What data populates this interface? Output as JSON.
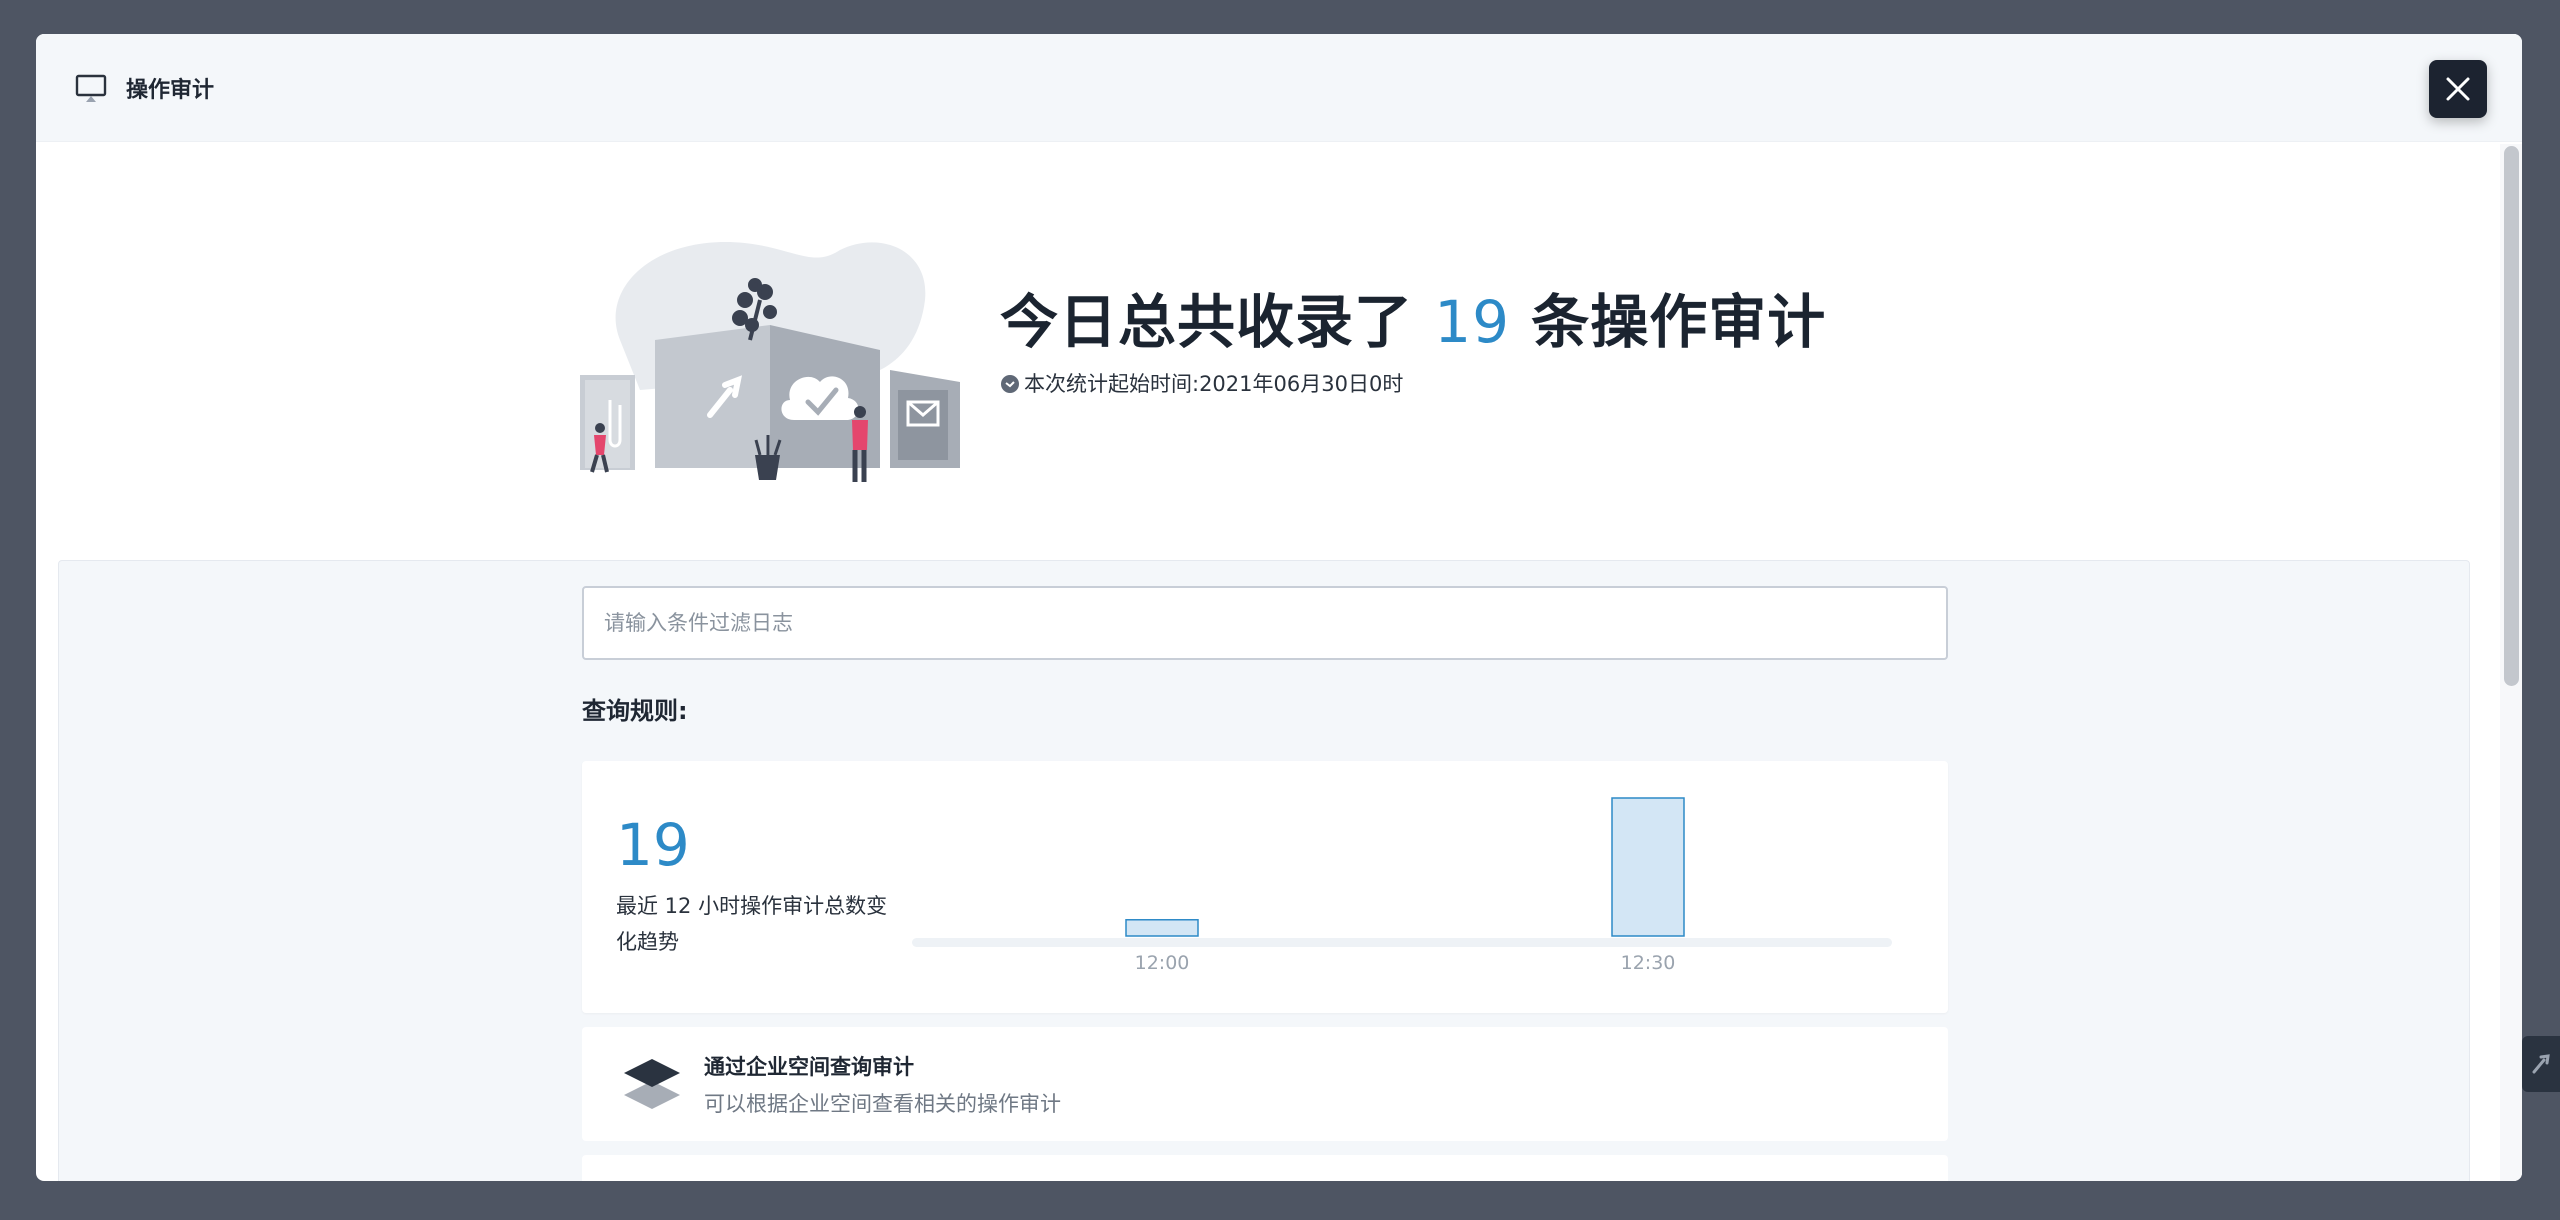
{
  "header": {
    "title": "操作审计",
    "icon": "monitor-icon",
    "close_icon": "close-icon"
  },
  "hero": {
    "title_prefix": "今日总共收录了",
    "count": "19",
    "title_suffix": "条操作审计",
    "subtitle": "本次统计起始时间:2021年06月30日0时",
    "illustration": "buildings-illustration"
  },
  "search": {
    "placeholder": "请输入条件过滤日志",
    "value": ""
  },
  "rules": {
    "label": "查询规则:"
  },
  "stats": {
    "count": "19",
    "description": "最近 12 小时操作审计总数变化趋势"
  },
  "chart_data": {
    "type": "bar",
    "categories": [
      "12:00",
      "12:30"
    ],
    "values": [
      2,
      17
    ],
    "title": "",
    "xlabel": "",
    "ylabel": "",
    "ylim": [
      0,
      17
    ],
    "grid": false,
    "colors": {
      "fill": "#d3e6f5",
      "stroke": "#2d8ac7"
    }
  },
  "filters": [
    {
      "title": "通过企业空间查询审计",
      "description": "可以根据企业空间查看相关的操作审计",
      "icon": "layers-icon"
    }
  ],
  "colors": {
    "accent": "#2d8ac7",
    "overlay": "#4e5563",
    "dark": "#1c2330"
  }
}
